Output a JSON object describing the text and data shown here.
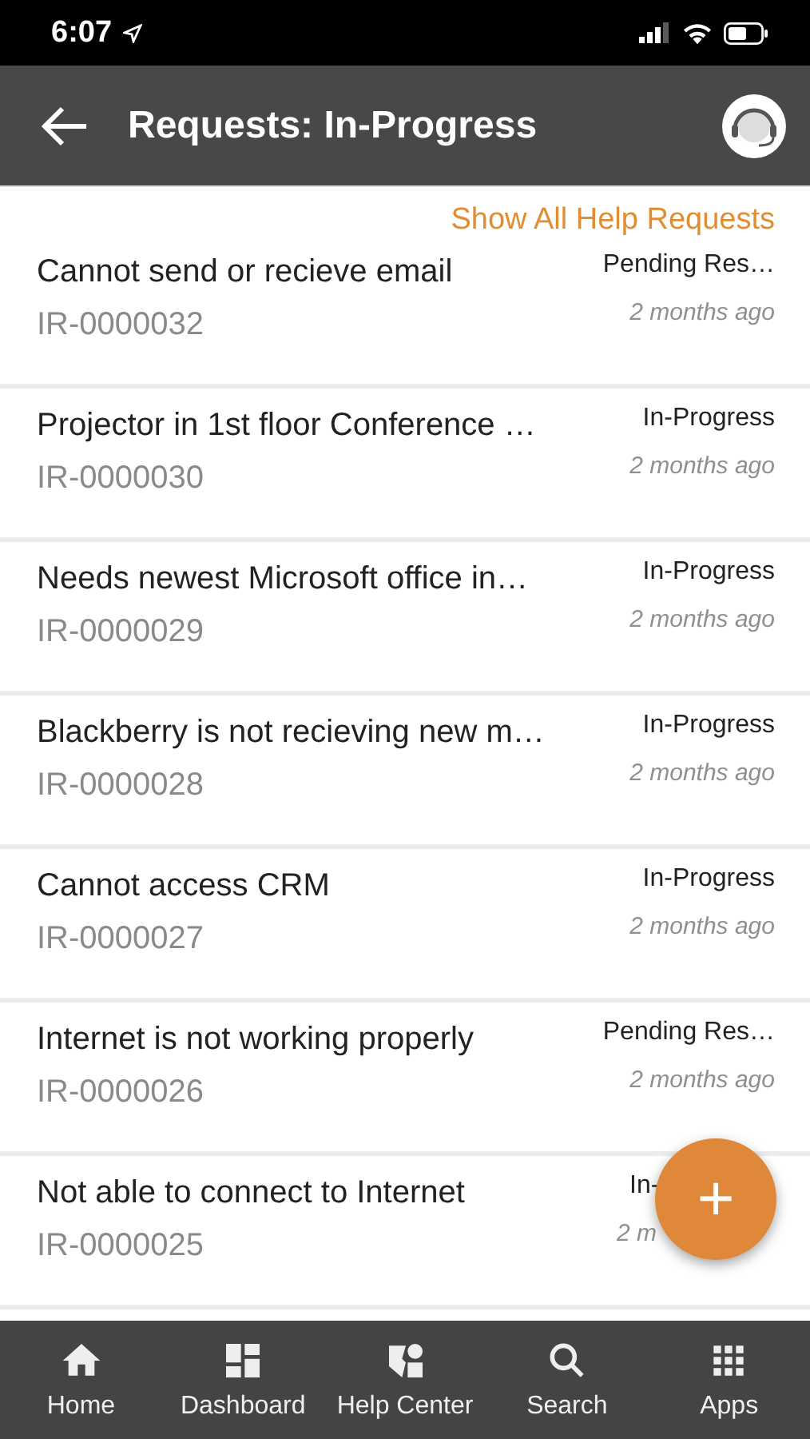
{
  "status_bar": {
    "time": "6:07"
  },
  "app_bar": {
    "title": "Requests: In-Progress"
  },
  "link": "Show All Help Requests",
  "requests": [
    {
      "title": "Cannot send or recieve email",
      "id": "IR-0000032",
      "status": "Pending Res…",
      "time": "2 months ago"
    },
    {
      "title": "Projector in 1st floor Conference …",
      "id": "IR-0000030",
      "status": "In-Progress",
      "time": "2 months ago"
    },
    {
      "title": "Needs newest Microsoft office in…",
      "id": "IR-0000029",
      "status": "In-Progress",
      "time": "2 months ago"
    },
    {
      "title": "Blackberry is not recieving new m…",
      "id": "IR-0000028",
      "status": "In-Progress",
      "time": "2 months ago"
    },
    {
      "title": "Cannot access CRM",
      "id": "IR-0000027",
      "status": "In-Progress",
      "time": "2 months ago"
    },
    {
      "title": "Internet is not working properly",
      "id": "IR-0000026",
      "status": "Pending Res…",
      "time": "2 months ago"
    },
    {
      "title": "Not able to connect to Internet",
      "id": "IR-0000025",
      "status": "In-",
      "time": "2 m",
      "covered": true
    }
  ],
  "fab": "+",
  "nav": [
    {
      "kind": "home",
      "label": "Home"
    },
    {
      "kind": "dashboard",
      "label": "Dashboard"
    },
    {
      "kind": "help",
      "label": "Help Center"
    },
    {
      "kind": "search",
      "label": "Search"
    },
    {
      "kind": "apps",
      "label": "Apps"
    }
  ]
}
